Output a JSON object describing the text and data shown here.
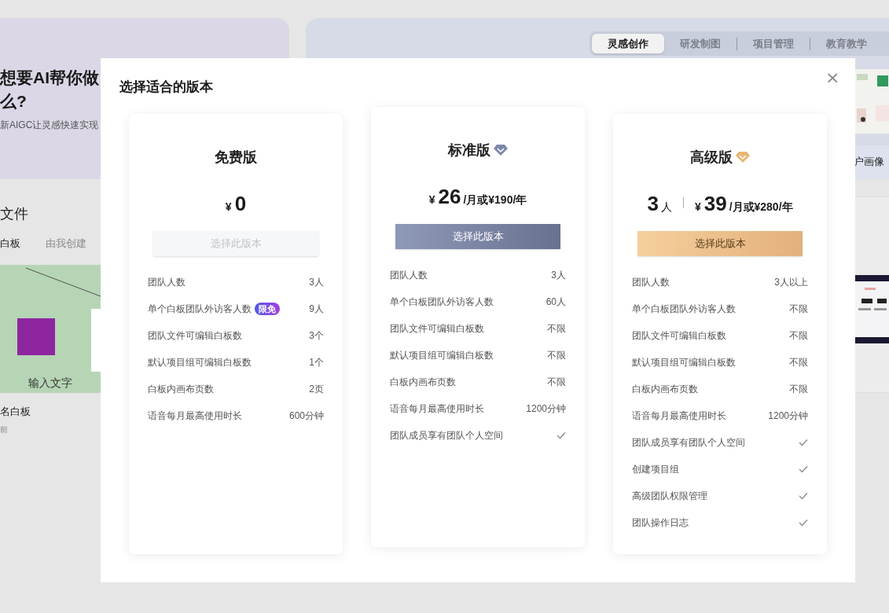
{
  "background": {
    "banner": {
      "title_lines": [
        "想要AI帮你做",
        "么?"
      ],
      "subtitle": "新AIGC让灵感快速实现"
    },
    "files": {
      "heading": "文件",
      "tabs": [
        {
          "label": "白板",
          "selected": true
        },
        {
          "label": "由我创建",
          "selected": false
        }
      ],
      "card": {
        "canvas_text": "输入文字",
        "name": "名白板",
        "time": "前"
      }
    },
    "templates": {
      "tabs": [
        {
          "label": "灵感创作",
          "selected": true
        },
        {
          "label": "研发制图",
          "selected": false
        },
        {
          "label": "项目管理",
          "selected": false
        },
        {
          "label": "教育教学",
          "selected": false
        }
      ],
      "caption": "户画像"
    }
  },
  "dialog": {
    "title": "选择适合的版本",
    "close": "×",
    "plans": [
      {
        "kind": "free",
        "name": "免费版",
        "price": {
          "currency": "¥",
          "amount": "0"
        },
        "button": {
          "label": "选择此版本",
          "disabled": true
        },
        "features": [
          {
            "label": "团队人数",
            "value": "3人"
          },
          {
            "label": "单个白板团队外访客人数",
            "badge": "限免",
            "value": "9人"
          },
          {
            "label": "团队文件可编辑白板数",
            "value": "3个"
          },
          {
            "label": "默认项目组可编辑白板数",
            "value": "1个"
          },
          {
            "label": "白板内画布页数",
            "value": "2页"
          },
          {
            "label": "语音每月最高使用时长",
            "value": "600分钟"
          }
        ]
      },
      {
        "kind": "standard",
        "name": "标准版",
        "price": {
          "currency": "¥",
          "amount": "26",
          "suffix": "/月或¥190/年"
        },
        "button": {
          "label": "选择此版本",
          "disabled": false
        },
        "features": [
          {
            "label": "团队人数",
            "value": "3人"
          },
          {
            "label": "单个白板团队外访客人数",
            "value": "60人"
          },
          {
            "label": "团队文件可编辑白板数",
            "value": "不限"
          },
          {
            "label": "默认项目组可编辑白板数",
            "value": "不限"
          },
          {
            "label": "白板内画布页数",
            "value": "不限"
          },
          {
            "label": "语音每月最高使用时长",
            "value": "1200分钟"
          },
          {
            "label": "团队成员享有团队个人空间",
            "included": true
          }
        ]
      },
      {
        "kind": "premium",
        "name": "高级版",
        "seats": {
          "count": "3",
          "unit": "人"
        },
        "price": {
          "currency": "¥",
          "amount": "39",
          "suffix": "/月或¥280/年"
        },
        "button": {
          "label": "选择此版本",
          "disabled": false
        },
        "features": [
          {
            "label": "团队人数",
            "value": "3人以上"
          },
          {
            "label": "单个白板团队外访客人数",
            "value": "不限"
          },
          {
            "label": "团队文件可编辑白板数",
            "value": "不限"
          },
          {
            "label": "默认项目组可编辑白板数",
            "value": "不限"
          },
          {
            "label": "白板内画布页数",
            "value": "不限"
          },
          {
            "label": "语音每月最高使用时长",
            "value": "1200分钟"
          },
          {
            "label": "团队成员享有团队个人空间",
            "included": true
          },
          {
            "label": "创建项目组",
            "included": true
          },
          {
            "label": "高级团队权限管理",
            "included": true
          },
          {
            "label": "团队操作日志",
            "included": true
          }
        ]
      }
    ]
  }
}
